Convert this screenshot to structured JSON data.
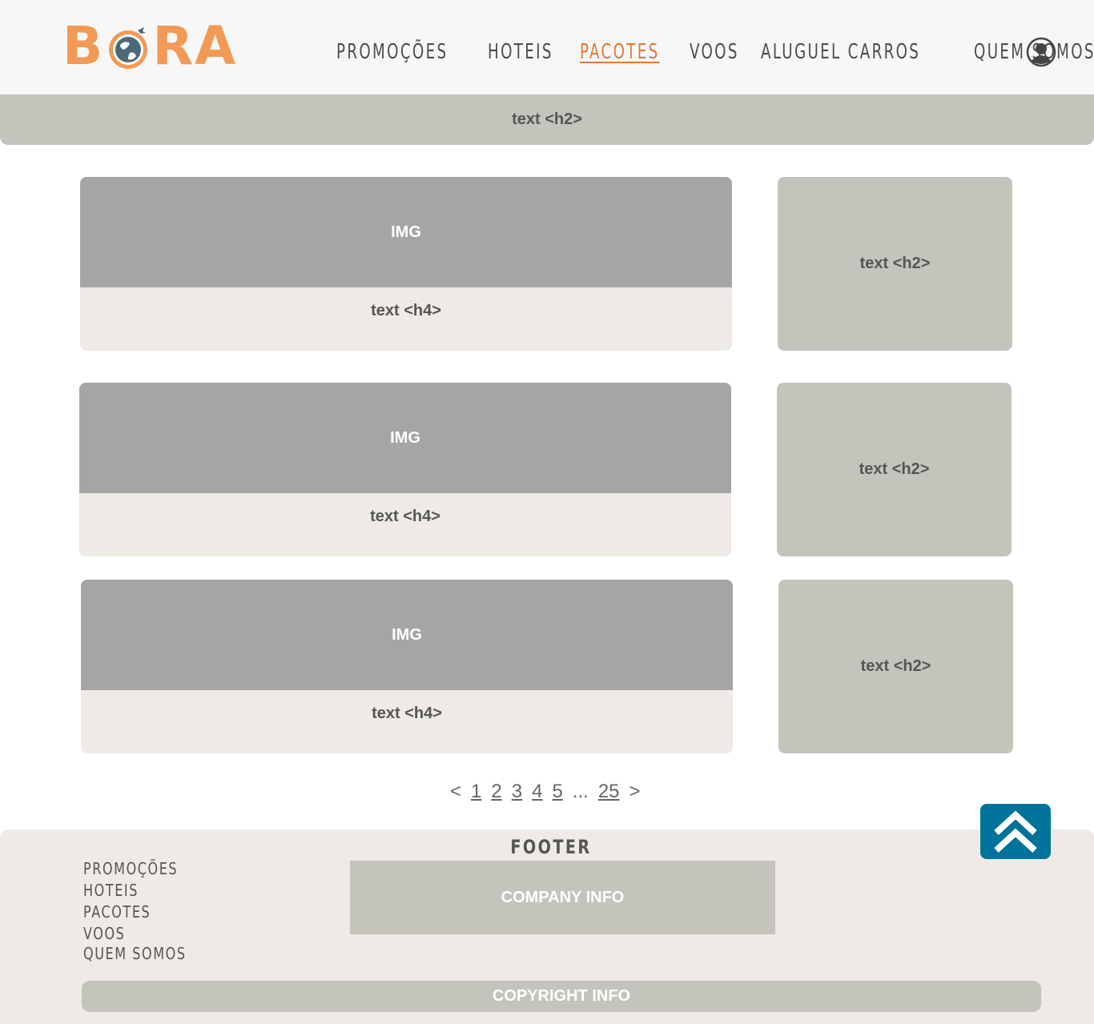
{
  "header": {
    "logo": {
      "left": "B",
      "right": "RA"
    },
    "nav": [
      {
        "label": "PROMOÇÕES",
        "active": false
      },
      {
        "label": "HOTEIS",
        "active": false
      },
      {
        "label": "PACOTES",
        "active": true
      },
      {
        "label": "VOOS",
        "active": false
      },
      {
        "label": "ALUGUEL CARROS",
        "active": false
      },
      {
        "label": "QUEM SOMOS",
        "active": false
      }
    ]
  },
  "title_bar": "text <h2>",
  "cards": [
    {
      "img": "IMG",
      "caption": "text <h4>",
      "side": "text <h2>"
    },
    {
      "img": "IMG",
      "caption": "text <h4>",
      "side": "text <h2>"
    },
    {
      "img": "IMG",
      "caption": "text <h4>",
      "side": "text <h2>"
    }
  ],
  "pagination": {
    "prev": "<",
    "pages": [
      "1",
      "2",
      "3",
      "4",
      "5"
    ],
    "ellipsis": "...",
    "last": "25",
    "next": ">"
  },
  "footer": {
    "title": "FOOTER",
    "links": [
      "PROMOÇÕES",
      "HOTEIS",
      "PACOTES",
      "VOOS",
      "QUEM SOMOS"
    ],
    "company": "COMPANY INFO",
    "copyright": "COPYRIGHT INFO"
  },
  "colors": {
    "brand_orange": "#f29a55",
    "active_nav": "#e07a30",
    "to_top": "#00739a"
  }
}
